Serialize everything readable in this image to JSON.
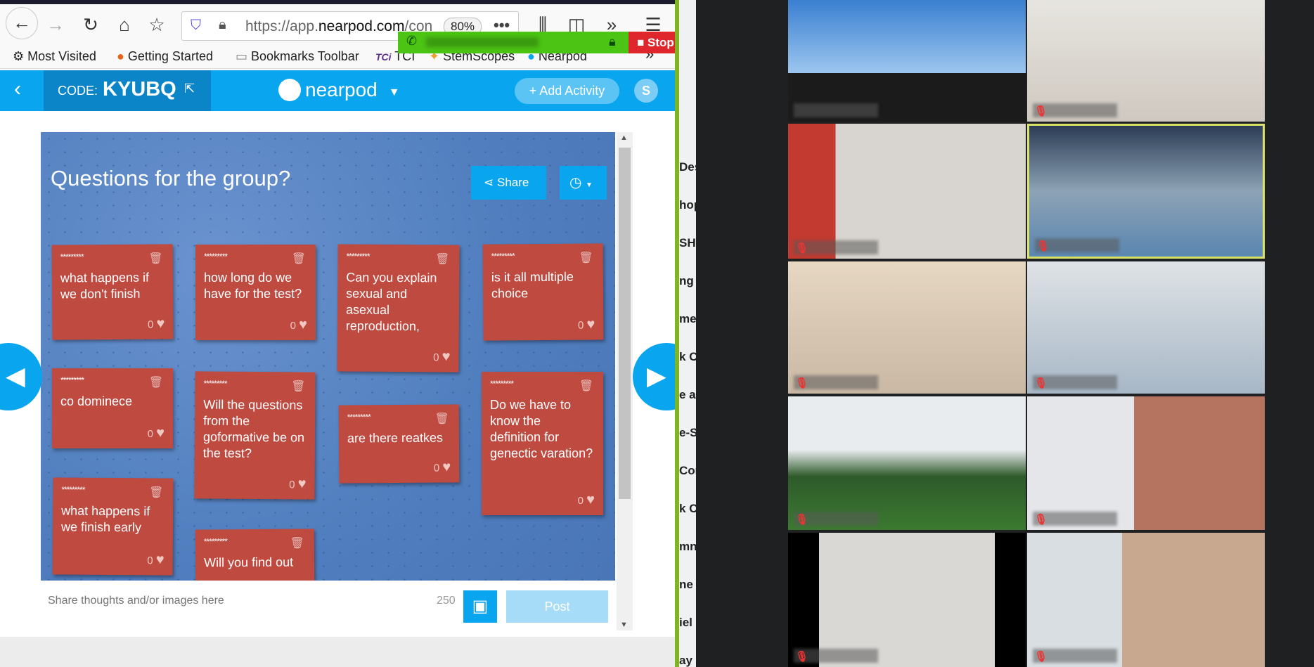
{
  "browser": {
    "url_prefix": "https://app.",
    "url_domain": "nearpod.com",
    "url_suffix": "/con",
    "zoom_level": "80%",
    "bookmarks": [
      "Most Visited",
      "Getting Started",
      "Bookmarks Toolbar",
      "TCI",
      "StemScopes",
      "Nearpod"
    ],
    "tci_logo": "TCi"
  },
  "screenshare": {
    "stop_label": "Stop Sh"
  },
  "nearpod": {
    "code_label": "CODE:",
    "code": "KYUBQ",
    "logo": "nearpod",
    "add_activity": "+ Add Activity",
    "avatar_letter": "S"
  },
  "board": {
    "title": "Questions for the group?",
    "share_label": "Share",
    "cards": [
      {
        "author": "*********",
        "text": "what happens if we don't finish",
        "likes": "0"
      },
      {
        "author": "*********",
        "text": "how long do we have for the test?",
        "likes": "0"
      },
      {
        "author": "*********",
        "text": "Can you explain sexual and asexual reproduction,",
        "likes": "0"
      },
      {
        "author": "*********",
        "text": "is it all multiple choice",
        "likes": "0"
      },
      {
        "author": "*********",
        "text": "co dominece",
        "likes": "0"
      },
      {
        "author": "*********",
        "text": "Will the questions from the goformative be on the test?",
        "likes": "0"
      },
      {
        "author": "*********",
        "text": "are there reatkes",
        "likes": "0"
      },
      {
        "author": "*********",
        "text": "Do we have to know the definition for genectic varation?",
        "likes": "0"
      },
      {
        "author": "*********",
        "text": "what happens if we finish early",
        "likes": "0"
      },
      {
        "author": "*********",
        "text": "Will you find out",
        "likes": ""
      }
    ],
    "input_placeholder": "Share thoughts and/or images here",
    "char_count": "250",
    "post_label": "Post"
  },
  "side_list": [
    "Des",
    "hop",
    "SH",
    "ng",
    "me",
    "k C",
    "e a",
    "e-S",
    "Cor",
    "k C",
    "mn",
    "ne",
    "iel",
    "ay"
  ],
  "colors": {
    "nearpod_blue": "#0aa5ef",
    "card_red": "#bf4a40",
    "active_speaker": "#d9e36a",
    "zoom_green": "#4cc413",
    "stop_red": "#e0262d"
  }
}
